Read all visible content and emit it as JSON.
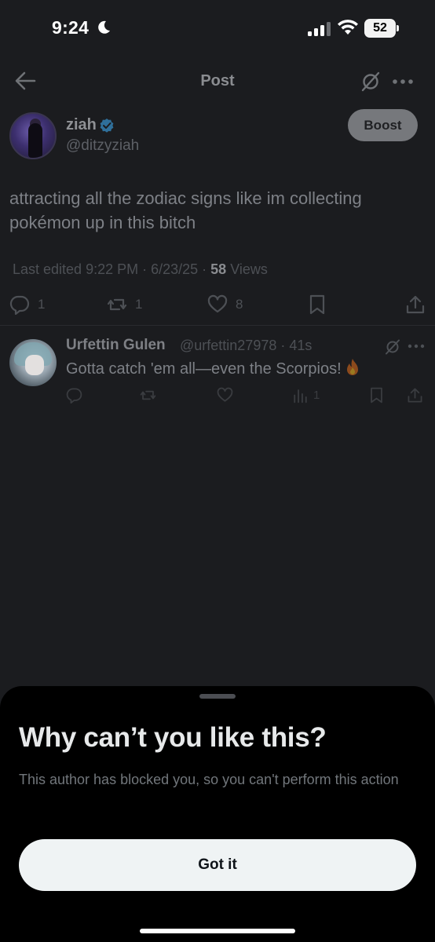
{
  "status_bar": {
    "time": "9:24",
    "battery": "52"
  },
  "header": {
    "title": "Post"
  },
  "post": {
    "author_name": "ziah",
    "handle": "@ditzyziah",
    "boost_label": "Boost",
    "text": "attracting all the zodiac signs like im collecting pokémon up in this bitch",
    "edited": "Last edited 9:22 PM · 6/23/25 · ",
    "views_count": "58",
    "views_label": " Views",
    "replies": "1",
    "reposts": "1",
    "likes": "8"
  },
  "reply": {
    "name": "Urfettin Gulen",
    "handle_time": "@urfettin27978 · 41s",
    "text": "Gotta catch 'em all—even the Scorpios!",
    "views": "1"
  },
  "sheet": {
    "title": "Why can’t you like this?",
    "body": "This author has blocked you, so you can't perform this action",
    "button_label": "Got it"
  },
  "colors": {
    "background": "#1b1c1f",
    "sheet": "#000000",
    "button": "#eff3f4",
    "verified": "#1d9bf0"
  }
}
